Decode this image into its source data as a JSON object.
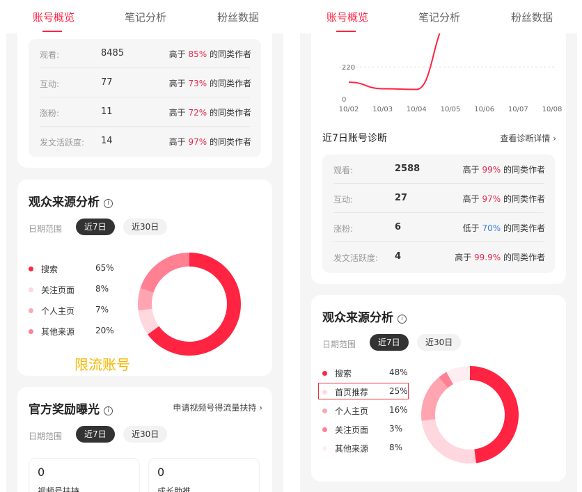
{
  "tabs": [
    "账号概览",
    "笔记分析",
    "粉丝数据"
  ],
  "left": {
    "stats": [
      {
        "label": "观看:",
        "value": "8485",
        "prefix": "高于",
        "pct": "85%",
        "suffix": "的同类作者",
        "color": "red"
      },
      {
        "label": "互动:",
        "value": "77",
        "prefix": "高于",
        "pct": "73%",
        "suffix": "的同类作者",
        "color": "red"
      },
      {
        "label": "涨粉:",
        "value": "11",
        "prefix": "高于",
        "pct": "72%",
        "suffix": "的同类作者",
        "color": "red"
      },
      {
        "label": "发文活跃度:",
        "value": "14",
        "prefix": "高于",
        "pct": "97%",
        "suffix": "的同类作者",
        "color": "red"
      }
    ],
    "audience": {
      "title": "观众来源分析",
      "info_icon": "ⓘ",
      "date_label": "日期范围",
      "pill_active": "近7日",
      "pill_inactive": "近30日",
      "legend": [
        {
          "name": "搜索",
          "pct": "65%",
          "value": 65,
          "color": "#ff2442"
        },
        {
          "name": "关注页面",
          "pct": "8%",
          "value": 8,
          "color": "#ffd7de"
        },
        {
          "name": "个人主页",
          "pct": "7%",
          "value": 7,
          "color": "#ffa5b2"
        },
        {
          "name": "其他来源",
          "pct": "20%",
          "value": 20,
          "color": "#ff8093"
        }
      ],
      "annotation": "限流账号"
    },
    "reward": {
      "title": "官方奖励曝光",
      "link": "申请视频号得流量扶持 ›",
      "date_label": "日期范围",
      "pill_active": "近7日",
      "pill_inactive": "近30日",
      "cards": [
        {
          "value": "0",
          "label": "视频号扶持"
        },
        {
          "value": "0",
          "label": "成长助推"
        }
      ]
    }
  },
  "right": {
    "chart_data": {
      "type": "line",
      "x": [
        "10/02",
        "10/03",
        "10/04",
        "10/05",
        "10/06",
        "10/07",
        "10/08"
      ],
      "y_ticks": [
        "220",
        "0"
      ],
      "series": [
        {
          "values": [
            115,
            70,
            65,
            600,
            null,
            null,
            null
          ],
          "color": "#ff2442"
        }
      ],
      "ylim": [
        0,
        500
      ]
    },
    "diagnosis_title": "近7日账号诊断",
    "diagnosis_link": "查看诊断详情 ›",
    "stats": [
      {
        "label": "观看:",
        "value": "2588",
        "prefix": "高于",
        "pct": "99%",
        "suffix": "的同类作者",
        "color": "red"
      },
      {
        "label": "互动:",
        "value": "27",
        "prefix": "高于",
        "pct": "97%",
        "suffix": "的同类作者",
        "color": "red"
      },
      {
        "label": "涨粉:",
        "value": "6",
        "prefix": "低于",
        "pct": "70%",
        "suffix": "的同类作者",
        "color": "blue"
      },
      {
        "label": "发文活跃度:",
        "value": "4",
        "prefix": "高于",
        "pct": "99.9%",
        "suffix": "的同类作者",
        "color": "red"
      }
    ],
    "audience": {
      "title": "观众来源分析",
      "info_icon": "ⓘ",
      "date_label": "日期范围",
      "pill_active": "近7日",
      "pill_inactive": "近30日",
      "legend": [
        {
          "name": "搜索",
          "pct": "48%",
          "value": 48,
          "color": "#ff2442"
        },
        {
          "name": "首页推荐",
          "pct": "25%",
          "value": 25,
          "color": "#ffd7de"
        },
        {
          "name": "个人主页",
          "pct": "16%",
          "value": 16,
          "color": "#ffa5b2"
        },
        {
          "name": "关注页面",
          "pct": "3%",
          "value": 3,
          "color": "#ff8093"
        },
        {
          "name": "其他来源",
          "pct": "8%",
          "value": 8,
          "color": "#ffeef1"
        }
      ]
    }
  }
}
